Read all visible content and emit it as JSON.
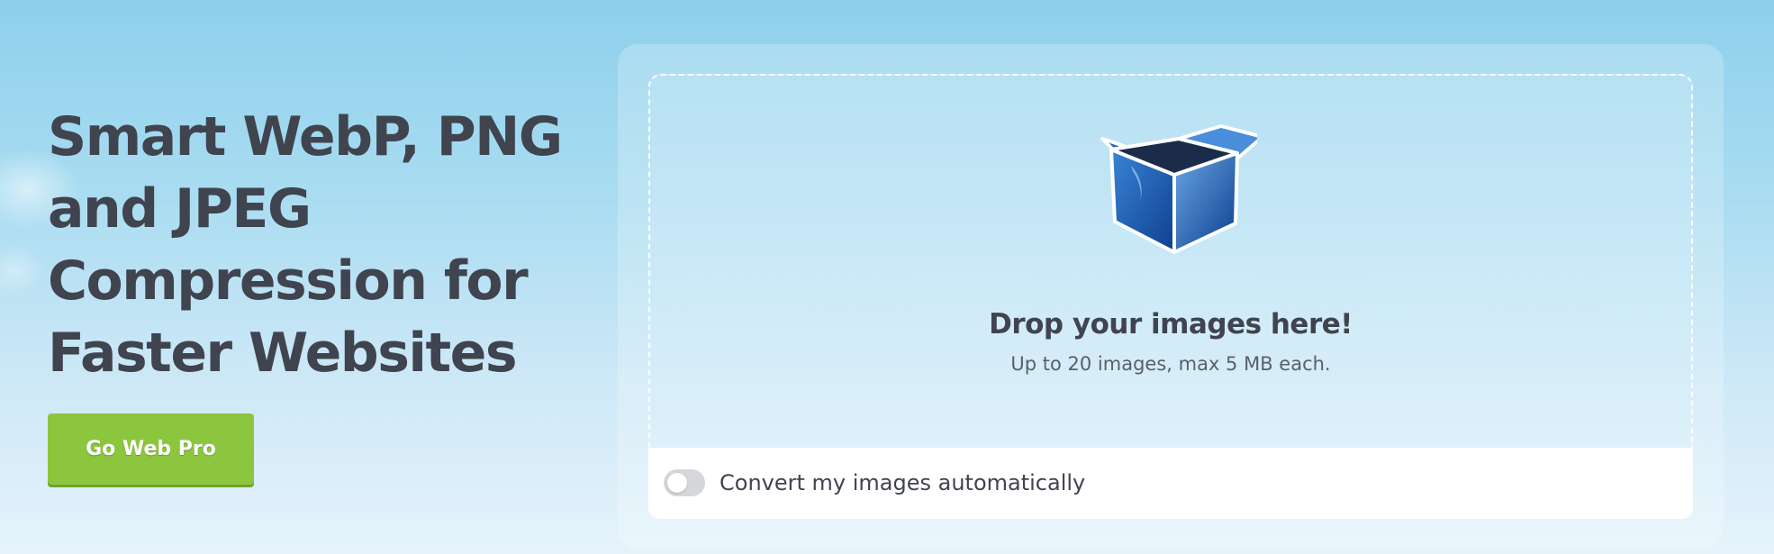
{
  "hero": {
    "title": "Smart WebP, PNG\nand JPEG\nCompression for\nFaster Websites",
    "cta_label": "Go Web Pro"
  },
  "upload": {
    "icon": "open-box-icon",
    "title": "Drop your images here!",
    "subtitle": "Up to 20 images, max 5 MB each.",
    "auto_convert_label": "Convert my images automatically",
    "auto_convert_enabled": false
  },
  "colors": {
    "cta_green": "#8cc63f",
    "heading_text": "#40444f",
    "box_blue": "#2a64b4"
  }
}
